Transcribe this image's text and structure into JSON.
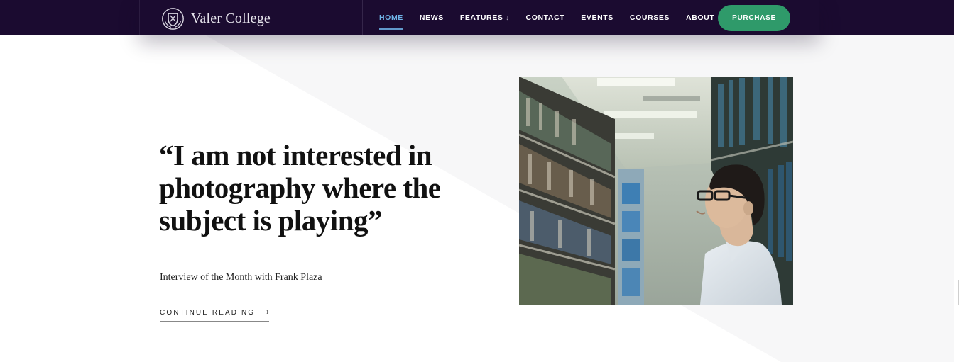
{
  "brand": {
    "name": "Valer College",
    "icon": "crest-shield-icon"
  },
  "nav": {
    "items": [
      {
        "label": "HOME",
        "active": true
      },
      {
        "label": "NEWS"
      },
      {
        "label": "FEATURES",
        "has_dropdown": true,
        "caret": "↓"
      },
      {
        "label": "CONTACT"
      },
      {
        "label": "EVENTS"
      },
      {
        "label": "COURSES"
      },
      {
        "label": "ABOUT"
      }
    ],
    "purchase_label": "PURCHASE"
  },
  "hero": {
    "quote": "“I am not interested in photography where the subject is playing”",
    "subtitle": "Interview of the Month with Frank Plaza",
    "cta_label": "CONTINUE READING",
    "cta_arrow": "⟶"
  },
  "colors": {
    "header_bg": "#1b0b30",
    "active_nav": "#6fb3e6",
    "purchase_bg": "#2f9a6a",
    "text_dark": "#111111"
  }
}
